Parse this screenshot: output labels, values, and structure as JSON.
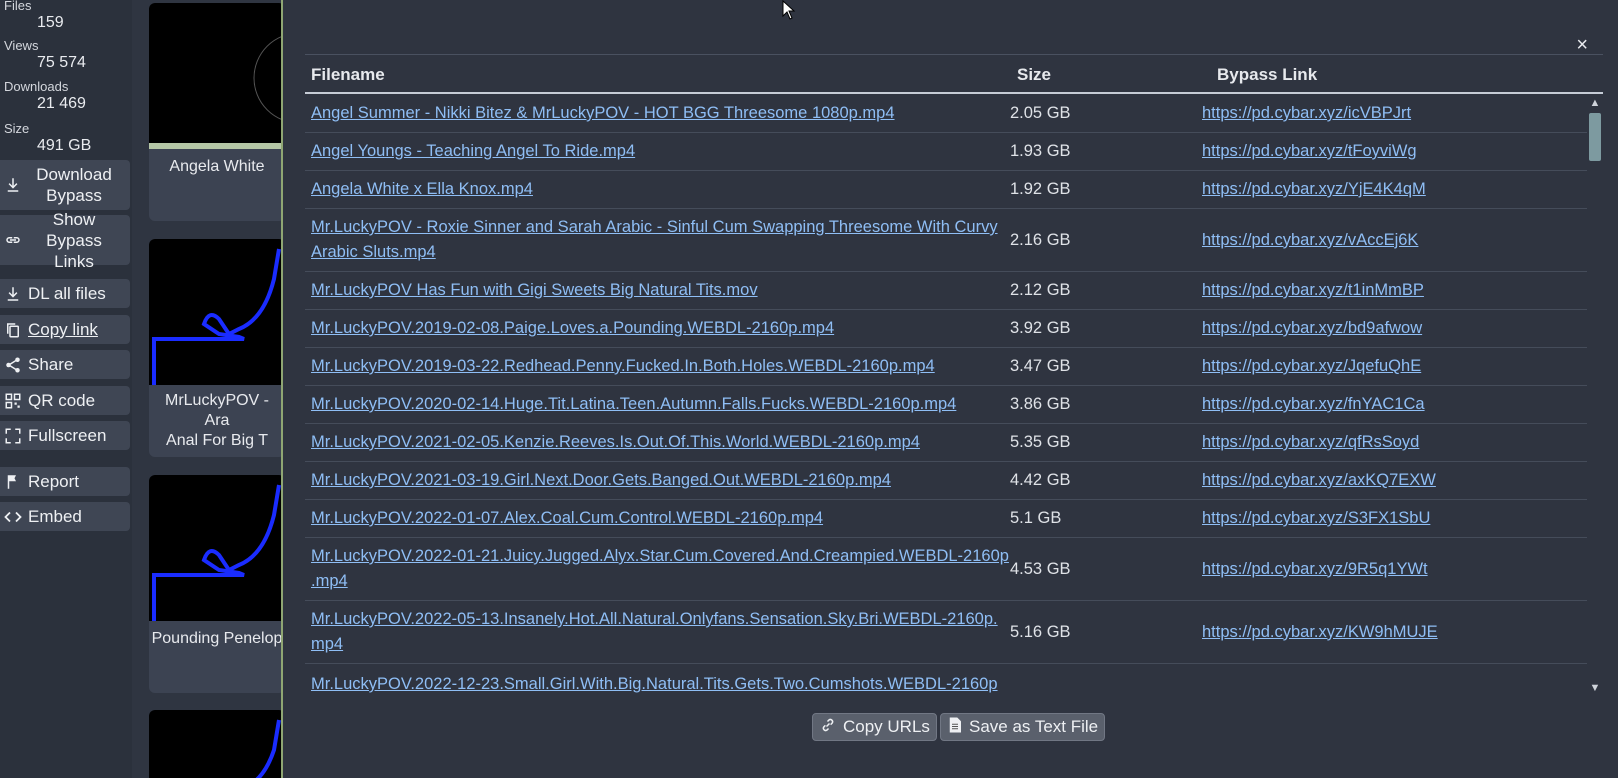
{
  "stats": [
    {
      "label": "Files",
      "value": "159"
    },
    {
      "label": "Views",
      "value": "75 574"
    },
    {
      "label": "Downloads",
      "value": "21 469"
    },
    {
      "label": "Size",
      "value": "491 GB"
    }
  ],
  "sidebar_buttons": {
    "download_bypass": "Download Bypass",
    "download_bypass_line1": "Download",
    "download_bypass_line2": "Bypass",
    "show_bypass_line1": "Show Bypass",
    "show_bypass_line2": "Links",
    "dl_all": "DL all files",
    "copy_link": "Copy link",
    "share": "Share",
    "qr_code": "QR code",
    "fullscreen": "Fullscreen",
    "report": "Report",
    "embed": "Embed"
  },
  "cards": [
    {
      "caption": "Angela White"
    },
    {
      "caption_line1": "MrLuckyPOV - Ara",
      "caption_line2": "Anal For Big T"
    },
    {
      "caption": "Pounding Penelop"
    },
    {
      "caption": ""
    }
  ],
  "modal": {
    "close": "×",
    "headers": {
      "filename": "Filename",
      "size": "Size",
      "link": "Bypass Link"
    },
    "rows": [
      {
        "filename": "Angel Summer - Nikki Bitez & MrLuckyPOV - HOT BGG Threesome 1080p.mp4",
        "size": "2.05 GB",
        "link": "https://pd.cybar.xyz/icVBPJrt"
      },
      {
        "filename": "Angel Youngs - Teaching Angel To Ride.mp4",
        "size": "1.93 GB",
        "link": "https://pd.cybar.xyz/tFoyviWg"
      },
      {
        "filename": "Angela White x Ella Knox.mp4",
        "size": "1.92 GB",
        "link": "https://pd.cybar.xyz/YjE4K4qM"
      },
      {
        "filename": "Mr.LuckyPOV - Roxie Sinner and Sarah Arabic - Sinful Cum Swapping Threesome With Curvy Arabic Sluts.mp4",
        "size": "2.16 GB",
        "link": "https://pd.cybar.xyz/vAccEj6K"
      },
      {
        "filename": "Mr.LuckyPOV Has Fun with Gigi Sweets Big Natural Tits.mov",
        "size": "2.12 GB",
        "link": "https://pd.cybar.xyz/t1inMmBP"
      },
      {
        "filename": "Mr.LuckyPOV.2019-02-08.Paige.Loves.a.Pounding.WEBDL-2160p.mp4",
        "size": "3.92 GB",
        "link": "https://pd.cybar.xyz/bd9afwow"
      },
      {
        "filename": "Mr.LuckyPOV.2019-03-22.Redhead.Penny.Fucked.In.Both.Holes.WEBDL-2160p.mp4",
        "size": "3.47 GB",
        "link": "https://pd.cybar.xyz/JqefuQhE"
      },
      {
        "filename": "Mr.LuckyPOV.2020-02-14.Huge.Tit.Latina.Teen.Autumn.Falls.Fucks.WEBDL-2160p.mp4",
        "size": "3.86 GB",
        "link": "https://pd.cybar.xyz/fnYAC1Ca"
      },
      {
        "filename": "Mr.LuckyPOV.2021-02-05.Kenzie.Reeves.Is.Out.Of.This.World.WEBDL-2160p.mp4",
        "size": "5.35 GB",
        "link": "https://pd.cybar.xyz/qfRsSoyd"
      },
      {
        "filename": "Mr.LuckyPOV.2021-03-19.Girl.Next.Door.Gets.Banged.Out.WEBDL-2160p.mp4",
        "size": "4.42 GB",
        "link": "https://pd.cybar.xyz/axKQ7EXW"
      },
      {
        "filename": "Mr.LuckyPOV.2022-01-07.Alex.Coal.Cum.Control.WEBDL-2160p.mp4",
        "size": "5.1 GB",
        "link": "https://pd.cybar.xyz/S3FX1SbU"
      },
      {
        "filename": "Mr.LuckyPOV.2022-01-21.Juicy.Jugged.Alyx.Star.Cum.Covered.And.Creampied.WEBDL-2160p.mp4",
        "size": "4.53 GB",
        "link": "https://pd.cybar.xyz/9R5q1YWt"
      },
      {
        "filename": "Mr.LuckyPOV.2022-05-13.Insanely.Hot.All.Natural.Onlyfans.Sensation.Sky.Bri.WEBDL-2160p.mp4",
        "size": "5.16 GB",
        "link": "https://pd.cybar.xyz/KW9hMUJE"
      },
      {
        "filename": "Mr.LuckyPOV.2022-12-23.Small.Girl.With.Big.Natural.Tits.Gets.Two.Cumshots.WEBDL-2160p",
        "size": "",
        "link": ""
      }
    ],
    "row_filename_lines": {
      "r3": [
        "Mr.LuckyPOV - Roxie Sinner and Sarah Arabic - Sinful Cum Swapping Threesome With Curvy",
        "Arabic Sluts.mp4"
      ],
      "r11": [
        "Mr.LuckyPOV.2022-01-21.Juicy.Jugged.Alyx.Star.Cum.Covered.And.Creampied.WEBDL-2160p",
        ".mp4"
      ],
      "r12": [
        "Mr.LuckyPOV.2022-05-13.Insanely.Hot.All.Natural.Onlyfans.Sensation.Sky.Bri.WEBDL-2160p.",
        "mp4"
      ]
    },
    "copy_urls": "Copy URLs",
    "save_text": "Save as Text File"
  }
}
